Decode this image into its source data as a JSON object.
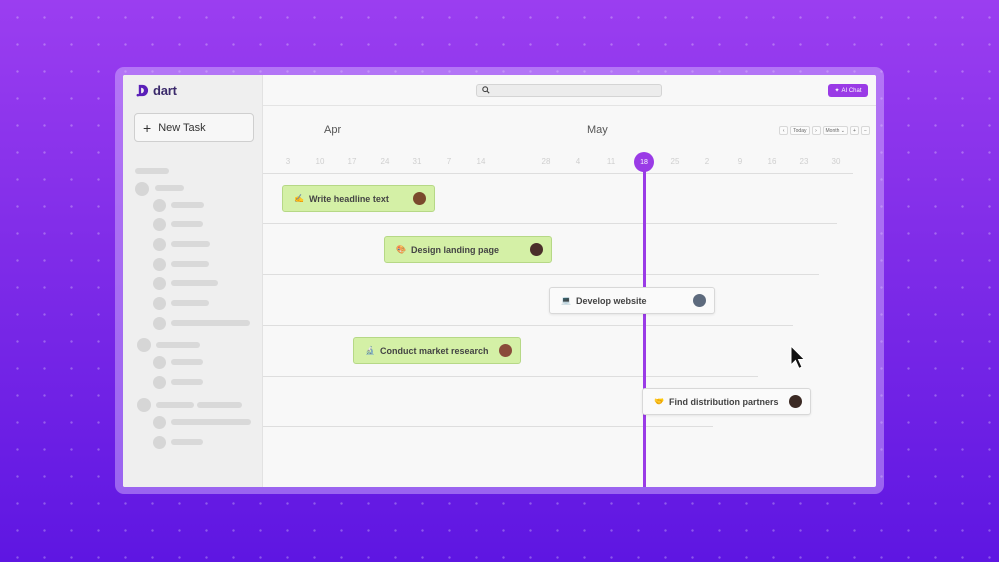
{
  "app": {
    "name": "dart"
  },
  "sidebar": {
    "new_task_label": "New Task"
  },
  "topbar": {
    "search_placeholder": "",
    "ai_chat_label": "AI Chat"
  },
  "timeline": {
    "months": [
      "Apr",
      "May"
    ],
    "days": [
      "3",
      "10",
      "17",
      "24",
      "31",
      "7",
      "14",
      "28",
      "4",
      "11",
      "25",
      "2",
      "9",
      "16",
      "23",
      "30"
    ],
    "today": "18",
    "controls": {
      "prev": "‹",
      "today": "Today",
      "next": "›",
      "view": "Month",
      "zoom_in": "+",
      "zoom_out": "−"
    }
  },
  "tasks": [
    {
      "emoji": "✍️",
      "title": "Write headline text",
      "color": "#d4f0a6",
      "avatar_color": "#7a4a2c"
    },
    {
      "emoji": "🎨",
      "title": "Design landing page",
      "color": "#d4f0a6",
      "avatar_color": "#4a2e2a"
    },
    {
      "emoji": "💻",
      "title": "Develop website",
      "color": "#fafafa",
      "avatar_color": "#5d6a7d"
    },
    {
      "emoji": "🔬",
      "title": "Conduct market research",
      "color": "#d4f0a6",
      "avatar_color": "#8a4b3a"
    },
    {
      "emoji": "🤝",
      "title": "Find distribution partners",
      "color": "#fafafa",
      "avatar_color": "#3b2a24"
    }
  ],
  "colors": {
    "accent": "#9a3be6",
    "background_top": "#9b3ef0",
    "background_bottom": "#5e16e2"
  }
}
